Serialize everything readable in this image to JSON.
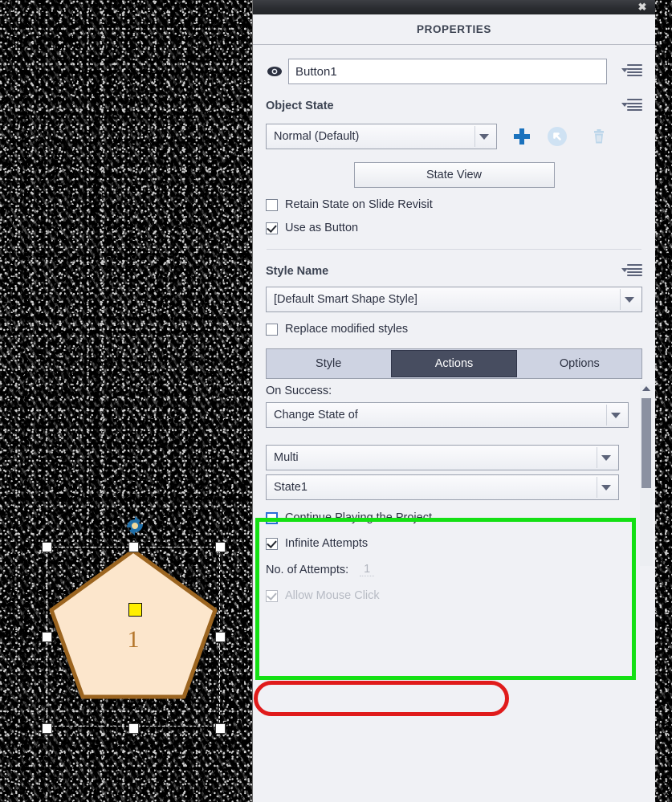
{
  "window": {
    "title": "PROPERTIES",
    "close_label": "✖"
  },
  "canvas": {
    "shape_number": "1",
    "shape_fill": "#fce6cc",
    "shape_stroke": "#9c6520",
    "rotate_icon": "rotate-handle-icon",
    "center_handle_color": "#ffef00"
  },
  "object": {
    "name_value": "Button1",
    "name_placeholder": "Button1",
    "visibility_icon": "eye-icon",
    "menu_icon": "panel-menu-icon"
  },
  "object_state": {
    "heading": "Object State",
    "state_dropdown_value": "Normal (Default)",
    "add_icon": "plus-icon",
    "duplicate_icon": "duplicate-state-icon",
    "delete_icon": "trash-icon",
    "state_view_label": "State View",
    "retain_state_label": "Retain State on Slide Revisit",
    "retain_state_checked": false,
    "use_as_button_label": "Use as Button",
    "use_as_button_checked": true
  },
  "style": {
    "heading": "Style Name",
    "style_dropdown_value": "[Default Smart Shape Style]",
    "replace_label": "Replace modified styles",
    "replace_checked": false
  },
  "tabs": {
    "items": [
      {
        "label": "Style",
        "active": false
      },
      {
        "label": "Actions",
        "active": true
      },
      {
        "label": "Options",
        "active": false
      }
    ]
  },
  "actions": {
    "on_success_label": "On Success:",
    "on_success_value": "Change State of",
    "target_value": "Multi",
    "state_value": "State1",
    "continue_playing_label": "Continue Playing the Project",
    "continue_playing_checked": false,
    "infinite_attempts_label": "Infinite Attempts",
    "infinite_attempts_checked": true,
    "attempts_label": "No. of Attempts:",
    "attempts_value": "1",
    "allow_mouse_click_label": "Allow Mouse Click",
    "allow_mouse_click_checked": true
  },
  "annotations": {
    "green_highlight_color": "#14e014",
    "red_highlight_color": "#e01b1b"
  }
}
